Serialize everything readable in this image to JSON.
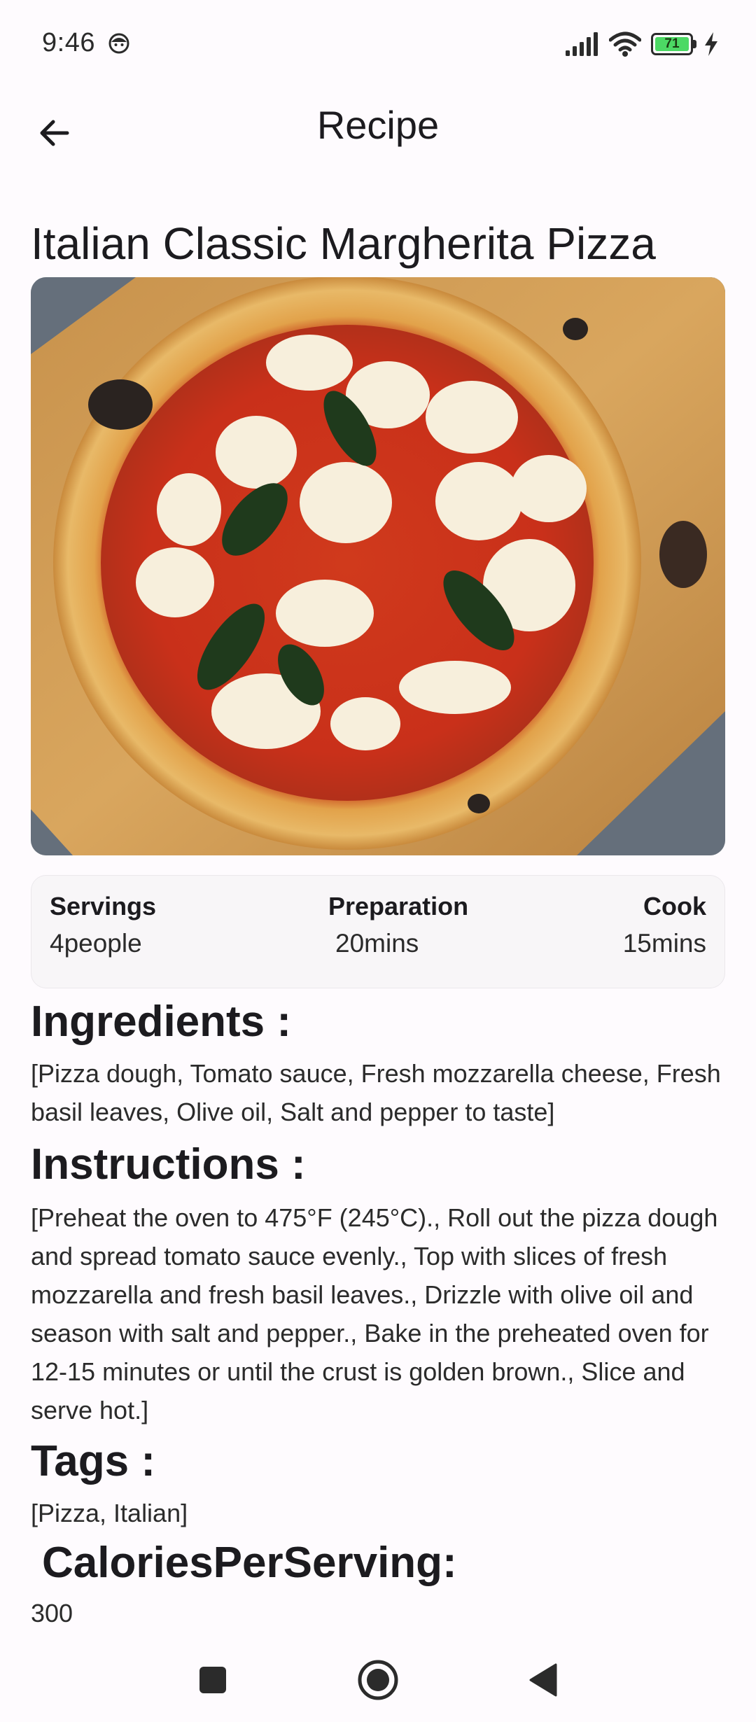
{
  "status_bar": {
    "time": "9:46",
    "battery_level": "71",
    "icons": [
      "face-notification-icon",
      "signal-icon",
      "wifi-icon",
      "battery-icon",
      "charging-bolt-icon"
    ]
  },
  "app_bar": {
    "title": "Recipe",
    "back_icon": "arrow-back-icon"
  },
  "recipe": {
    "title": "Italian Classic Margherita Pizza",
    "image_icon": "pizza-photo",
    "info": {
      "servings_label": "Servings",
      "servings_value": "4people",
      "preparation_label": "Preparation",
      "preparation_value": "20mins",
      "cook_label": "Cook",
      "cook_value": "15mins"
    },
    "ingredients_heading": "Ingredients :",
    "ingredients_text": "[Pizza dough, Tomato sauce, Fresh mozzarella cheese, Fresh basil leaves, Olive oil, Salt and pepper to taste]",
    "instructions_heading": "Instructions :",
    "instructions_text": "[Preheat the oven to 475°F (245°C)., Roll out the pizza dough and spread tomato sauce evenly., Top with slices of fresh mozzarella and fresh basil leaves., Drizzle with olive oil and season with salt and pepper., Bake in the preheated oven for 12-15 minutes or until the crust is golden brown., Slice and serve hot.]",
    "tags_heading": "Tags :",
    "tags_text": "[Pizza, Italian]",
    "calories_heading": "CaloriesPerServing:",
    "calories_value": "300"
  },
  "nav_bar": {
    "icons": [
      "recents-square-icon",
      "home-circle-icon",
      "back-triangle-icon"
    ]
  },
  "colors": {
    "background": "#fefbfe",
    "card": "#f8f6f8",
    "text": "#1c1b1f",
    "battery": "#4cd964"
  }
}
